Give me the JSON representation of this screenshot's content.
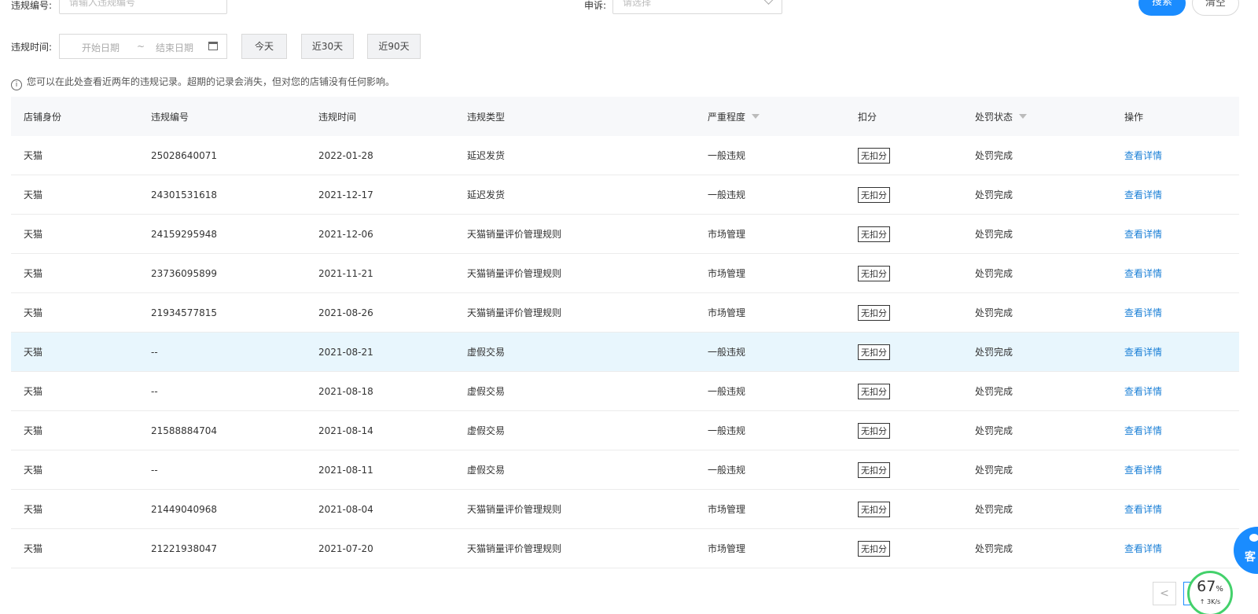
{
  "filters": {
    "violation_id_label": "违规编号:",
    "violation_id_placeholder": "请输入违规编号",
    "appeal_label": "申诉:",
    "appeal_placeholder": "请选择",
    "search_label": "搜索",
    "clear_label": "清空",
    "time_label": "违规时间:",
    "start_date_placeholder": "开始日期",
    "range_separator": "~",
    "end_date_placeholder": "结束日期",
    "today_label": "今天",
    "last30_label": "近30天",
    "last90_label": "近90天"
  },
  "notice": "您可以在此处查看近两年的违规记录。超期的记录会消失，但对您的店铺没有任何影响。",
  "table": {
    "headers": [
      "店铺身份",
      "违规编号",
      "违规时间",
      "违规类型",
      "严重程度",
      "扣分",
      "处罚状态",
      "操作"
    ],
    "rows": [
      {
        "shop": "天猫",
        "id": "25028640071",
        "time": "2022-01-28",
        "type": "延迟发货",
        "severity": "一般违规",
        "deduct": "无扣分",
        "status": "处罚完成",
        "action": "查看详情"
      },
      {
        "shop": "天猫",
        "id": "24301531618",
        "time": "2021-12-17",
        "type": "延迟发货",
        "severity": "一般违规",
        "deduct": "无扣分",
        "status": "处罚完成",
        "action": "查看详情"
      },
      {
        "shop": "天猫",
        "id": "24159295948",
        "time": "2021-12-06",
        "type": "天猫销量评价管理规则",
        "severity": "市场管理",
        "deduct": "无扣分",
        "status": "处罚完成",
        "action": "查看详情"
      },
      {
        "shop": "天猫",
        "id": "23736095899",
        "time": "2021-11-21",
        "type": "天猫销量评价管理规则",
        "severity": "市场管理",
        "deduct": "无扣分",
        "status": "处罚完成",
        "action": "查看详情"
      },
      {
        "shop": "天猫",
        "id": "21934577815",
        "time": "2021-08-26",
        "type": "天猫销量评价管理规则",
        "severity": "市场管理",
        "deduct": "无扣分",
        "status": "处罚完成",
        "action": "查看详情"
      },
      {
        "shop": "天猫",
        "id": "--",
        "time": "2021-08-21",
        "type": "虚假交易",
        "severity": "一般违规",
        "deduct": "无扣分",
        "status": "处罚完成",
        "action": "查看详情"
      },
      {
        "shop": "天猫",
        "id": "--",
        "time": "2021-08-18",
        "type": "虚假交易",
        "severity": "一般违规",
        "deduct": "无扣分",
        "status": "处罚完成",
        "action": "查看详情"
      },
      {
        "shop": "天猫",
        "id": "21588884704",
        "time": "2021-08-14",
        "type": "虚假交易",
        "severity": "一般违规",
        "deduct": "无扣分",
        "status": "处罚完成",
        "action": "查看详情"
      },
      {
        "shop": "天猫",
        "id": "--",
        "time": "2021-08-11",
        "type": "虚假交易",
        "severity": "一般违规",
        "deduct": "无扣分",
        "status": "处罚完成",
        "action": "查看详情"
      },
      {
        "shop": "天猫",
        "id": "21449040968",
        "time": "2021-08-04",
        "type": "天猫销量评价管理规则",
        "severity": "市场管理",
        "deduct": "无扣分",
        "status": "处罚完成",
        "action": "查看详情"
      },
      {
        "shop": "天猫",
        "id": "21221938047",
        "time": "2021-07-20",
        "type": "天猫销量评价管理规则",
        "severity": "市场管理",
        "deduct": "无扣分",
        "status": "处罚完成",
        "action": "查看详情"
      }
    ]
  },
  "pagination": {
    "prev": "<"
  },
  "service_widget": {
    "label": "客"
  },
  "speed_widget": {
    "percent": "67",
    "percent_unit": "%",
    "rate": "↑ 3K/s"
  },
  "colors": {
    "primary": "#1a8cff",
    "link": "#1a7fd6",
    "highlight_row": "#e8f6fd",
    "speed_ring": "#43d16b"
  }
}
